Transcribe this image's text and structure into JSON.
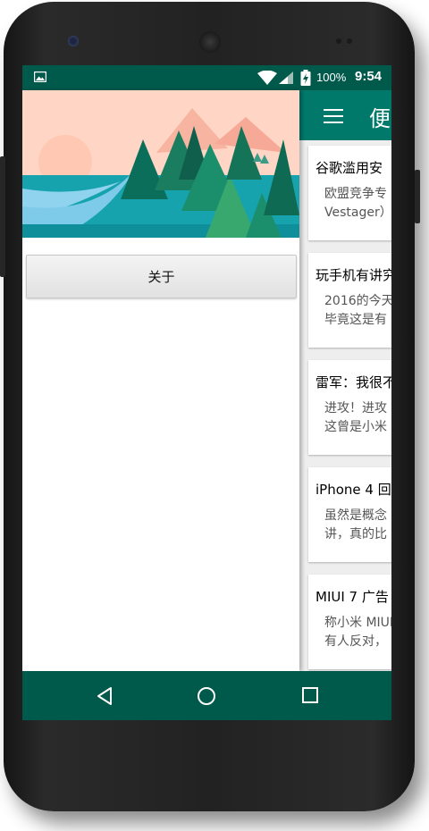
{
  "status_bar": {
    "battery_percent": "100%",
    "time": "9:54"
  },
  "app_bar": {
    "title": "便"
  },
  "drawer": {
    "about_label": "关于"
  },
  "cards": [
    {
      "title": "谷歌滥用安",
      "body_line1": "欧盟竞争专",
      "body_line2": "Vestager）"
    },
    {
      "title": "玩手机有讲究",
      "body_line1": "2016的今天",
      "body_line2": "毕竟这是有"
    },
    {
      "title": "雷军：我很不",
      "body_line1": "进攻！进攻",
      "body_line2": "这曾是小米"
    },
    {
      "title": "iPhone 4 回",
      "body_line1": "虽然是概念",
      "body_line2": "讲，真的比"
    },
    {
      "title": "MIUI 7 广告",
      "body_line1": "称小米 MIUI",
      "body_line2": "有人反对，"
    }
  ],
  "colors": {
    "status_bar": "#005a4c",
    "app_bar": "#00796b",
    "nav_bar": "#005a4c"
  },
  "icons": [
    "image-icon",
    "wifi-icon",
    "signal-icon",
    "battery-icon",
    "menu-icon",
    "back-icon",
    "home-icon",
    "recents-icon"
  ]
}
